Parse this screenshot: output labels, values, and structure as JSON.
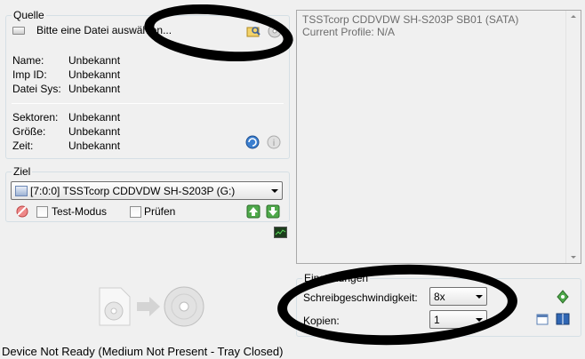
{
  "source": {
    "title": "Quelle",
    "file_placeholder": "Bitte eine Datei auswählen...",
    "fields": [
      {
        "label": "Name:",
        "value": "Unbekannt"
      },
      {
        "label": "Imp ID:",
        "value": "Unbekannt"
      },
      {
        "label": "Datei Sys:",
        "value": "Unbekannt"
      }
    ],
    "fields2": [
      {
        "label": "Sektoren:",
        "value": "Unbekannt"
      },
      {
        "label": "Größe:",
        "value": "Unbekannt"
      },
      {
        "label": "Zeit:",
        "value": "Unbekannt"
      }
    ]
  },
  "target": {
    "title": "Ziel",
    "drive": "[7:0:0] TSSTcorp CDDVDW SH-S203P (G:)",
    "test_mode": "Test-Modus",
    "verify": "Prüfen"
  },
  "info": {
    "line1": "TSSTcorp CDDVDW SH-S203P SB01 (SATA)",
    "line2": "Current Profile: N/A"
  },
  "settings": {
    "title": "Einstellungen",
    "speed_label": "Schreibgeschwindigkeit:",
    "speed_value": "8x",
    "copies_label": "Kopien:",
    "copies_value": "1"
  },
  "status": "Device Not Ready (Medium Not Present - Tray Closed)"
}
